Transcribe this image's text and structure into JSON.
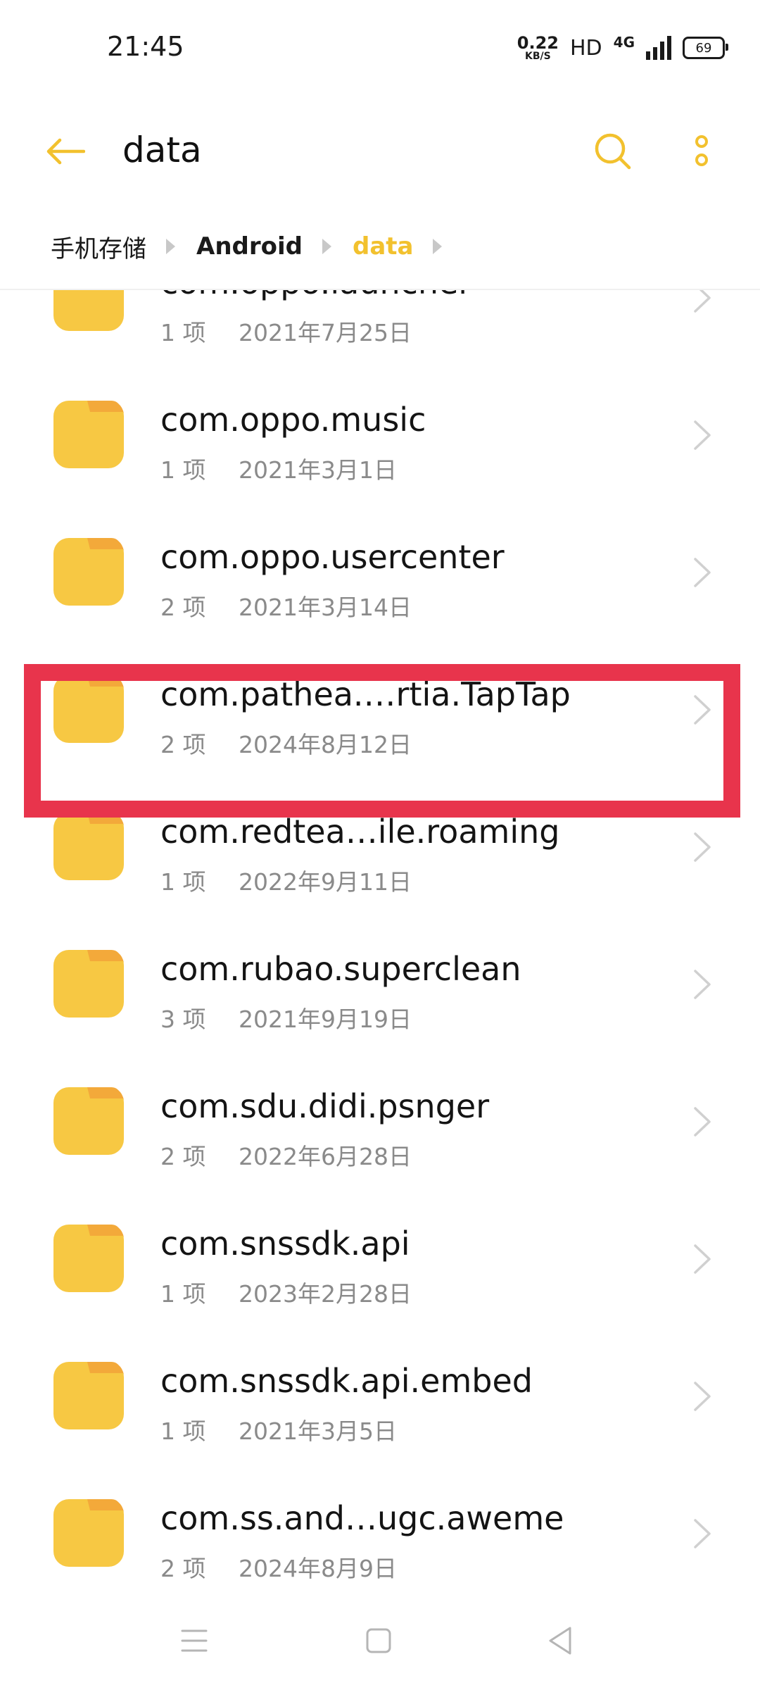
{
  "status_bar": {
    "time": "21:45",
    "net_speed_value": "0.22",
    "net_speed_unit": "KB/S",
    "hd_label": "HD",
    "network_type": "4G",
    "battery": "69"
  },
  "header": {
    "title": "data",
    "back_icon": "arrow-left-icon",
    "search_icon": "search-icon",
    "more_icon": "more-vertical-icon"
  },
  "breadcrumb": [
    "手机存储",
    "Android",
    "data"
  ],
  "items": [
    {
      "name": "com.oppo.launcher",
      "count": "1 项",
      "date": "2021年7月25日"
    },
    {
      "name": "com.oppo.music",
      "count": "1 项",
      "date": "2021年3月1日"
    },
    {
      "name": "com.oppo.usercenter",
      "count": "2 项",
      "date": "2021年3月14日"
    },
    {
      "name": "com.pathea.…rtia.TapTap",
      "count": "2 项",
      "date": "2024年8月12日"
    },
    {
      "name": "com.redtea…ile.roaming",
      "count": "1 项",
      "date": "2022年9月11日"
    },
    {
      "name": "com.rubao.superclean",
      "count": "3 项",
      "date": "2021年9月19日"
    },
    {
      "name": "com.sdu.didi.psnger",
      "count": "2 项",
      "date": "2022年6月28日"
    },
    {
      "name": "com.snssdk.api",
      "count": "1 项",
      "date": "2023年2月28日"
    },
    {
      "name": "com.snssdk.api.embed",
      "count": "1 项",
      "date": "2021年3月5日"
    },
    {
      "name": "com.ss.and…ugc.aweme",
      "count": "2 项",
      "date": "2024年8月9日"
    }
  ],
  "colors": {
    "accent": "#f2c12e",
    "folder_body": "#f7c843",
    "folder_tab": "#f3a93a",
    "highlight": "#e8344c"
  }
}
